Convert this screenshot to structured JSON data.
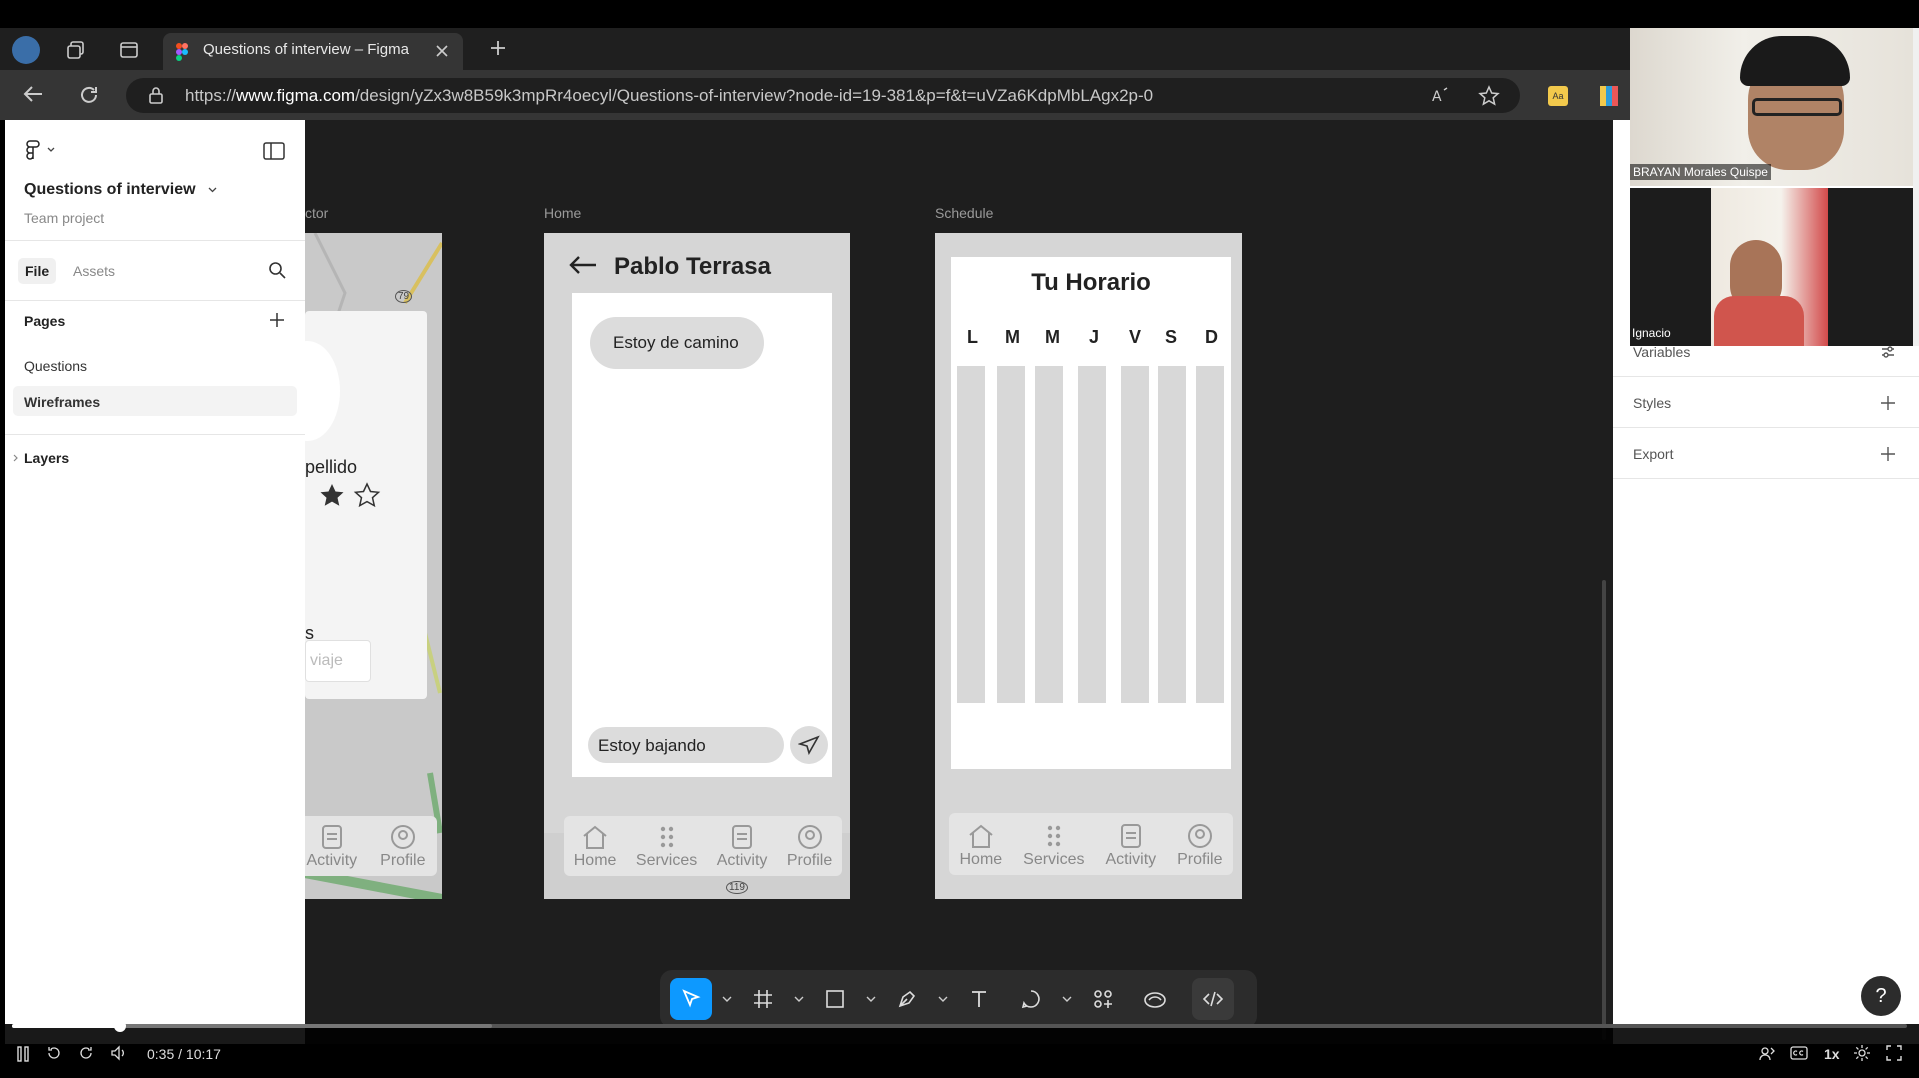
{
  "browser": {
    "tab_title": "Questions of interview – Figma",
    "url_prefix": "https://",
    "url_domain": "www.figma.com",
    "url_path": "/design/yZx3w8B59k3mpRr4oecyl/Questions-of-interview?node-id=19-381&p=f&t=uVZa6KdpMbLAgx2p-0"
  },
  "left_panel": {
    "file_name": "Questions of interview",
    "project": "Team project",
    "tab_file": "File",
    "tab_assets": "Assets",
    "pages_title": "Pages",
    "pages": [
      "Questions",
      "Wireframes"
    ],
    "layers_title": "Layers"
  },
  "right_panel": {
    "variables": "Variables",
    "styles": "Styles",
    "export": "Export"
  },
  "video_call": {
    "participant_1": "BRAYAN Morales Quispe",
    "participant_2": "Ignacio"
  },
  "frames": {
    "left_label": "ctor",
    "left_text_name": "pellido",
    "left_text_s": "s",
    "left_button": "viaje",
    "home_label": "Home",
    "schedule_label": "Schedule"
  },
  "chat": {
    "title": "Pablo Terrasa",
    "bubble": "Estoy de camino",
    "input": "Estoy bajando"
  },
  "schedule": {
    "title": "Tu Horario",
    "days": [
      "L",
      "M",
      "M",
      "J",
      "V",
      "S",
      "D"
    ]
  },
  "nav": {
    "home": "Home",
    "services": "Services",
    "activity": "Activity",
    "profile": "Profile"
  },
  "map": {
    "road_79": "79",
    "road_119": "119"
  },
  "video": {
    "time": "0:35 / 10:17",
    "speed": "1x",
    "progress": 0.057
  },
  "colors": {
    "accent": "#0d99ff",
    "canvas": "#1e1e1e"
  }
}
